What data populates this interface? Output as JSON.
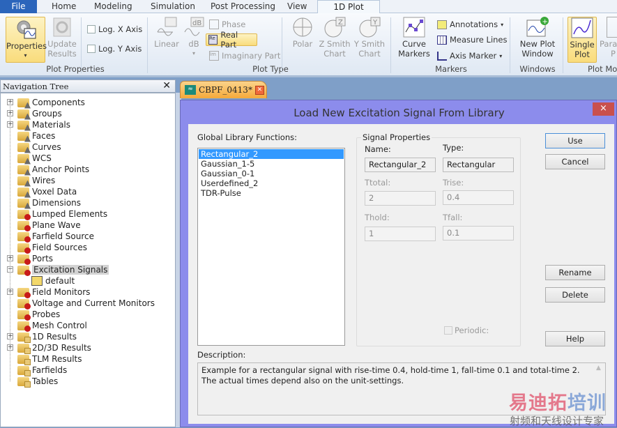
{
  "ribbon_tabs": [
    "File",
    "Home",
    "Modeling",
    "Simulation",
    "Post Processing",
    "View",
    "1D Plot"
  ],
  "ribbon": {
    "properties": "Properties",
    "update_results": [
      "Update",
      "Results"
    ],
    "log_x": "Log. X Axis",
    "log_y": "Log. Y Axis",
    "group_plot_properties": "Plot Properties",
    "linear": "Linear",
    "db": "dB",
    "phase": "Phase",
    "real_part": "Real Part",
    "imaginary_part": "Imaginary Part",
    "group_plot_type": "Plot Type",
    "polar": "Polar",
    "z_smith": [
      "Z Smith",
      "Chart"
    ],
    "y_smith": [
      "Y Smith",
      "Chart"
    ],
    "curve_markers": [
      "Curve",
      "Markers"
    ],
    "annotations": "Annotations",
    "measure_lines": "Measure Lines",
    "axis_marker": "Axis Marker",
    "group_markers": "Markers",
    "new_plot_window": [
      "New Plot",
      "Window"
    ],
    "group_windows": "Windows",
    "single_plot": [
      "Single",
      "Plot"
    ],
    "para": [
      "Para",
      "P"
    ],
    "group_plot_mode": "Plot Mo"
  },
  "nav": {
    "title": "Navigation Tree",
    "items": [
      {
        "label": "Components",
        "icon": "tri",
        "exp": "+"
      },
      {
        "label": "Groups",
        "icon": "tri",
        "exp": "+"
      },
      {
        "label": "Materials",
        "icon": "tri",
        "exp": "+"
      },
      {
        "label": "Faces",
        "icon": "tri"
      },
      {
        "label": "Curves",
        "icon": "tri"
      },
      {
        "label": "WCS",
        "icon": "tri"
      },
      {
        "label": "Anchor Points",
        "icon": "tri"
      },
      {
        "label": "Wires",
        "icon": "tri"
      },
      {
        "label": "Voxel Data",
        "icon": "tri"
      },
      {
        "label": "Dimensions",
        "icon": "tri"
      },
      {
        "label": "Lumped Elements",
        "icon": "gear"
      },
      {
        "label": "Plane Wave",
        "icon": "gear"
      },
      {
        "label": "Farfield Source",
        "icon": "gear"
      },
      {
        "label": "Field Sources",
        "icon": "gear"
      },
      {
        "label": "Ports",
        "icon": "gear",
        "exp": "+"
      },
      {
        "label": "Excitation Signals",
        "icon": "gear",
        "exp": "−",
        "selected": true
      },
      {
        "label": "default",
        "icon": "signal",
        "child": true
      },
      {
        "label": "Field Monitors",
        "icon": "gear",
        "exp": "+"
      },
      {
        "label": "Voltage and Current Monitors",
        "icon": "gear"
      },
      {
        "label": "Probes",
        "icon": "gear"
      },
      {
        "label": "Mesh Control",
        "icon": "gear"
      },
      {
        "label": "1D Results",
        "icon": "docs",
        "exp": "+"
      },
      {
        "label": "2D/3D Results",
        "icon": "docs",
        "exp": "+"
      },
      {
        "label": "TLM Results",
        "icon": "docs"
      },
      {
        "label": "Farfields",
        "icon": "docs"
      },
      {
        "label": "Tables",
        "icon": "docs"
      }
    ]
  },
  "doc_tab": "CBPF_0413*",
  "dialog": {
    "title": "Load New Excitation Signal From Library",
    "close": "×",
    "library_label": "Global Library Functions:",
    "functions": [
      "Rectangular_2",
      "Gaussian_1-5",
      "Gaussian_0-1",
      "Userdefined_2",
      "TDR-Pulse"
    ],
    "selected_index": 0,
    "group_label": "Signal Properties",
    "name_label": "Name:",
    "name_value": "Rectangular_2",
    "type_label": "Type:",
    "type_value": "Rectangular",
    "ttotal_label": "Ttotal:",
    "ttotal_value": "2",
    "trise_label": "Trise:",
    "trise_value": "0.4",
    "thold_label": "Thold:",
    "thold_value": "1",
    "tfall_label": "Tfall:",
    "tfall_value": "0.1",
    "periodic_label": "Periodic:",
    "buttons": {
      "use": "Use",
      "cancel": "Cancel",
      "rename": "Rename",
      "delete": "Delete",
      "help": "Help"
    },
    "description_label": "Description:",
    "description": "Example for a rectangular signal with rise-time 0.4, hold-time 1, fall-time 0.1 and total-time 2. The actual times depend also on the unit-settings."
  },
  "watermark": {
    "line1a": "易迪拓",
    "line1b": "培训",
    "line2": "射频和天线设计专家"
  }
}
